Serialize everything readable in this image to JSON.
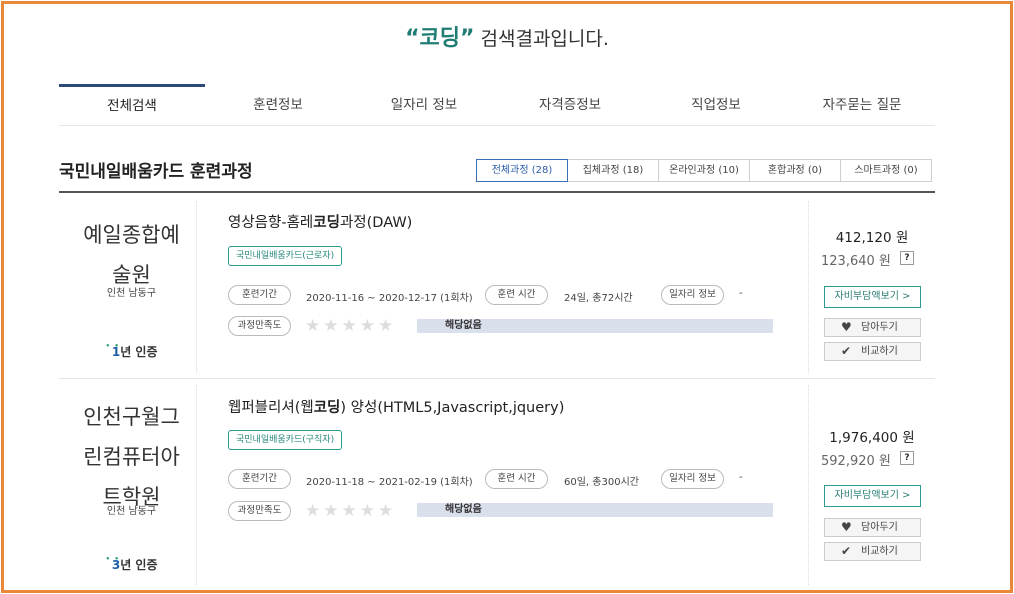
{
  "search": {
    "keyword": "“코딩”",
    "result_suffix": " 검색결과입니다."
  },
  "tabs": [
    {
      "label": "전체검색",
      "active": true
    },
    {
      "label": "훈련정보"
    },
    {
      "label": "일자리 정보"
    },
    {
      "label": "자격증정보"
    },
    {
      "label": "직업정보"
    },
    {
      "label": "자주묻는 질문"
    }
  ],
  "section": {
    "title": "국민내일배움카드 훈련과정",
    "filters": [
      "전체과정 (28)",
      "집체과정 (18)",
      "온라인과정 (10)",
      "혼합과정 (0)",
      "스마트과정 (0)"
    ]
  },
  "labels": {
    "period": "훈련기간",
    "time": "훈련 시간",
    "job_info": "일자리 정보",
    "satisfaction": "과정만족도",
    "no_rating": "해당없음",
    "self_pay_button": "자비부담액보기 >",
    "wishlist": "담아두기",
    "compare": "비교하기",
    "help_mark": "?",
    "stars": "★★★★★",
    "cert_suffix": "년 인증",
    "cert_dots": "• •",
    "dash": "-"
  },
  "courses": [
    {
      "institution_line1": "예일종합예",
      "institution_line2": "술원",
      "institution_line3": "",
      "location": "인천 남동구",
      "cert_years": "1",
      "title_pre": "영상음향-홈레",
      "title_kw": "코딩",
      "title_post": "과정(DAW)",
      "badge": "국민내일배움카드(근로자)",
      "period": "2020-11-16 ~ 2020-12-17 (1회차)",
      "hours": "24일, 총72시간",
      "job_info": "-",
      "price": "412,120 원",
      "self_pay": "123,640 원"
    },
    {
      "institution_line1": "인천구월그",
      "institution_line2": "린컴퓨터아",
      "institution_line3": "트학원",
      "location": "인천 남동구",
      "cert_years": "3",
      "title_pre": "웹퍼블리셔(웹",
      "title_kw": "코딩",
      "title_post": ") 양성(HTML5,Javascript,jquery)",
      "badge": "국민내일배움카드(구직자)",
      "period": "2020-11-18 ~ 2021-02-19 (1회차)",
      "hours": "60일, 총300시간",
      "job_info": "-",
      "price": "1,976,400 원",
      "self_pay": "592,920 원"
    }
  ],
  "colors": {
    "frame": "#e8893a",
    "accent": "#1f7d74",
    "tab_active": "#2c4a79",
    "badge": "#2a9b8e"
  }
}
